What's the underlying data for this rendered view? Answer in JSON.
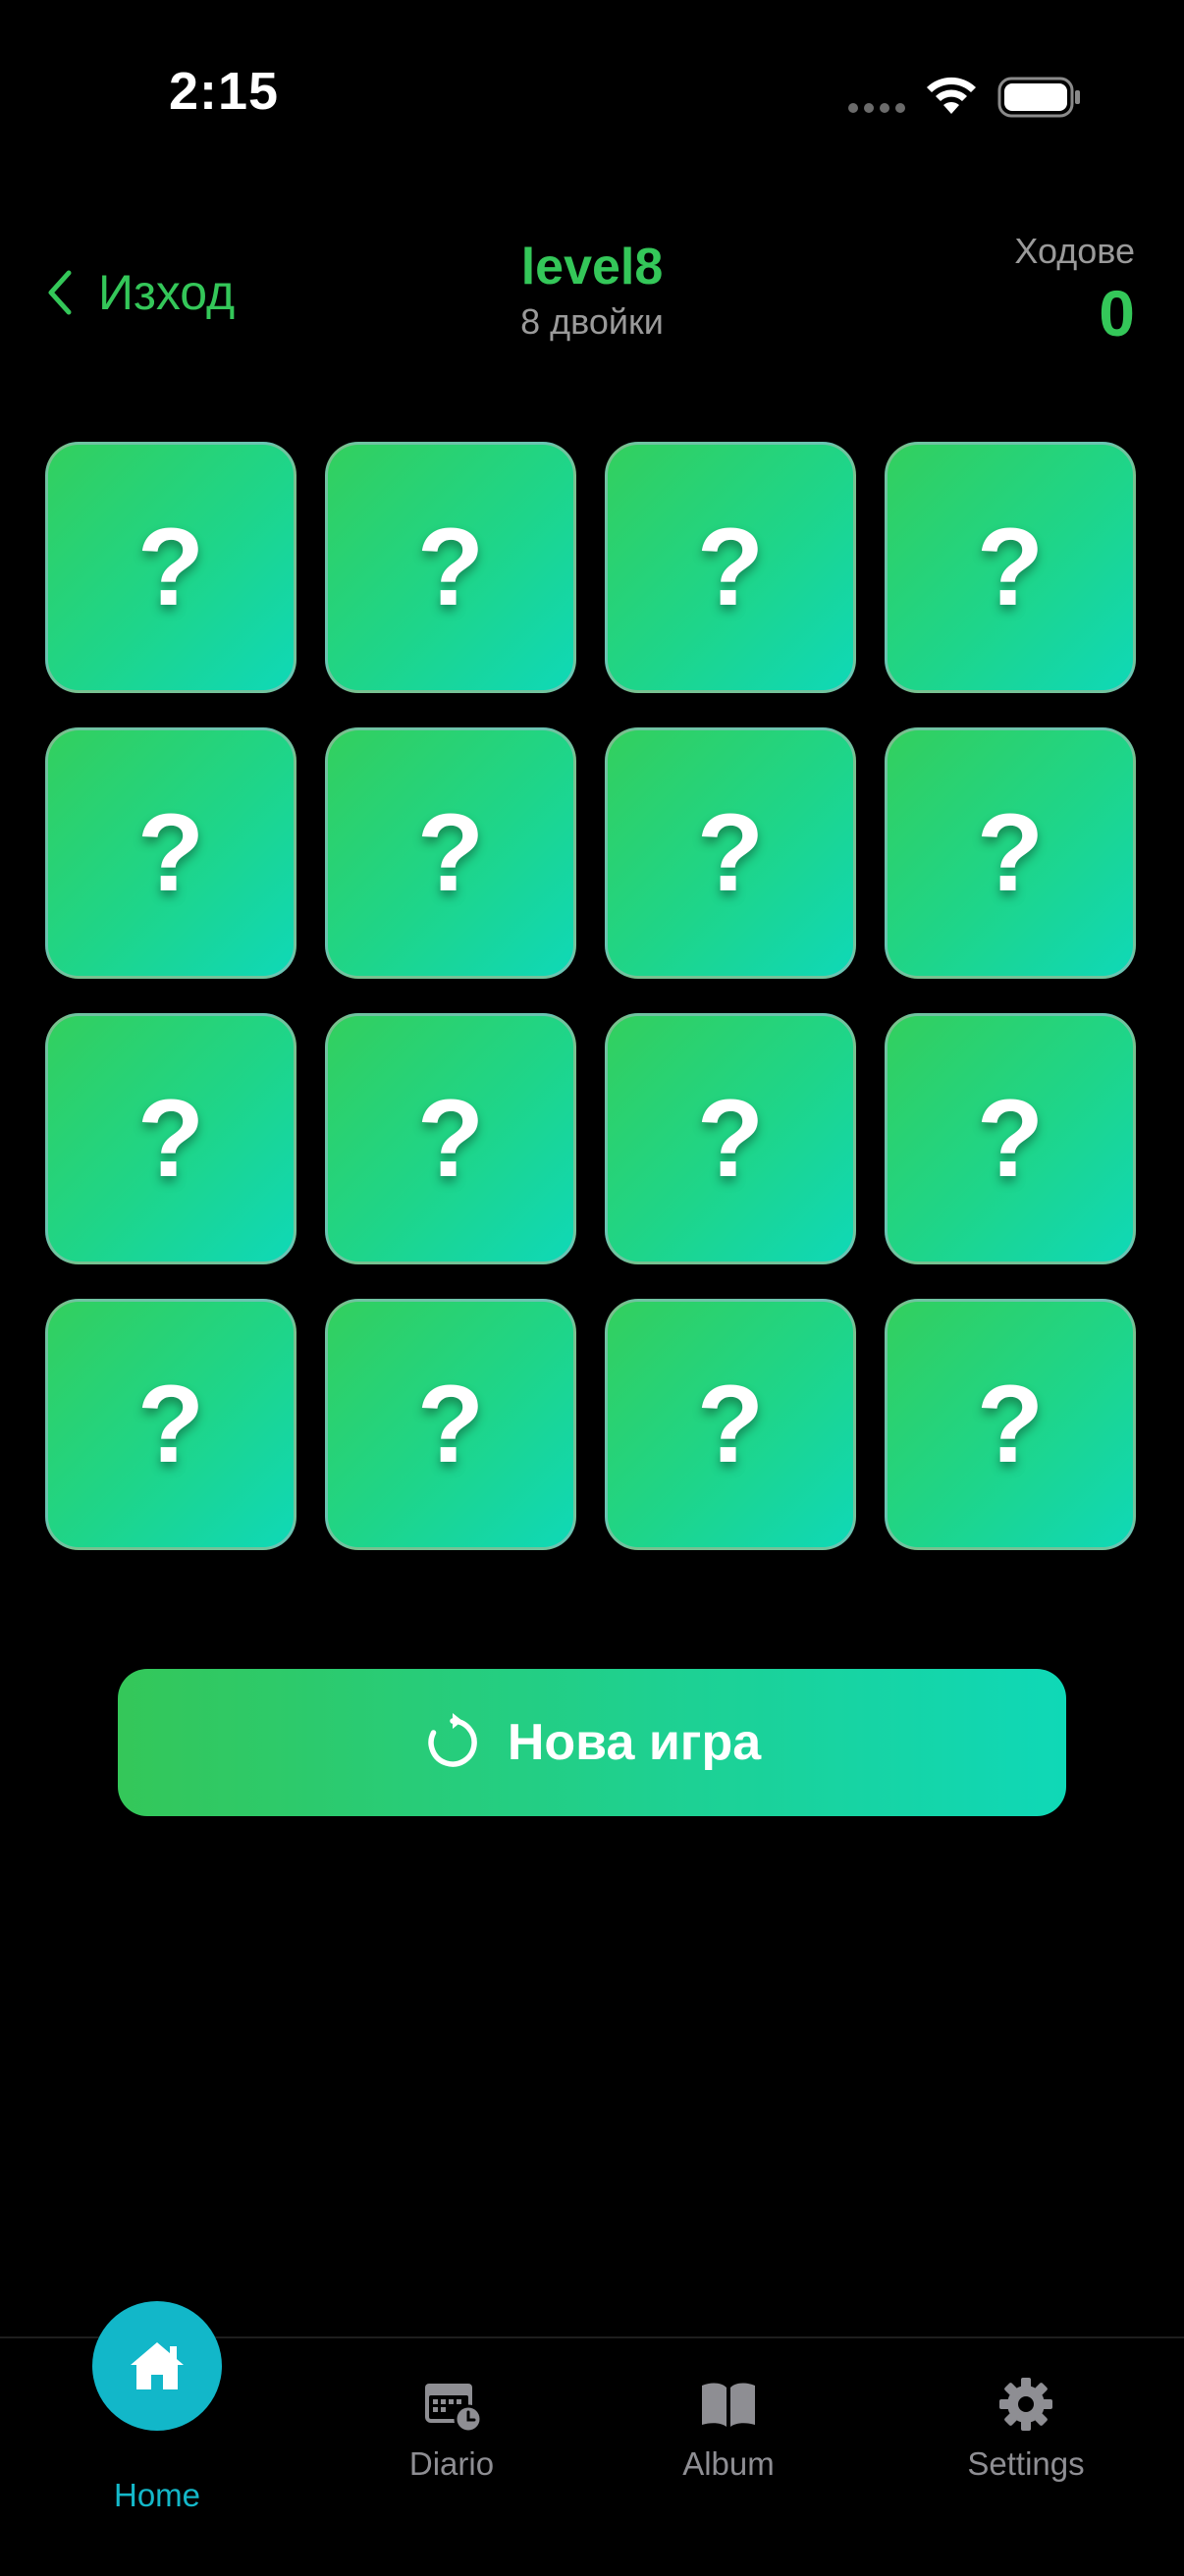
{
  "status_bar": {
    "time": "2:15"
  },
  "header": {
    "back_label": "Изход",
    "title": "level8",
    "subtitle": "8 двойки",
    "moves_label": "Ходове",
    "moves_value": "0"
  },
  "cards": [
    {
      "face": "?"
    },
    {
      "face": "?"
    },
    {
      "face": "?"
    },
    {
      "face": "?"
    },
    {
      "face": "?"
    },
    {
      "face": "?"
    },
    {
      "face": "?"
    },
    {
      "face": "?"
    },
    {
      "face": "?"
    },
    {
      "face": "?"
    },
    {
      "face": "?"
    },
    {
      "face": "?"
    },
    {
      "face": "?"
    },
    {
      "face": "?"
    },
    {
      "face": "?"
    },
    {
      "face": "?"
    }
  ],
  "new_game": {
    "label": "Нова игра"
  },
  "tabs": [
    {
      "label": "Home",
      "icon": "home-icon",
      "active": true
    },
    {
      "label": "Diario",
      "icon": "calendar-clock-icon",
      "active": false
    },
    {
      "label": "Album",
      "icon": "book-icon",
      "active": false
    },
    {
      "label": "Settings",
      "icon": "gear-icon",
      "active": false
    }
  ],
  "colors": {
    "accent_green": "#34c759",
    "active_tab": "#14b8c9",
    "card_gradient_start": "#33cf5e",
    "card_gradient_end": "#0fd8b7"
  }
}
